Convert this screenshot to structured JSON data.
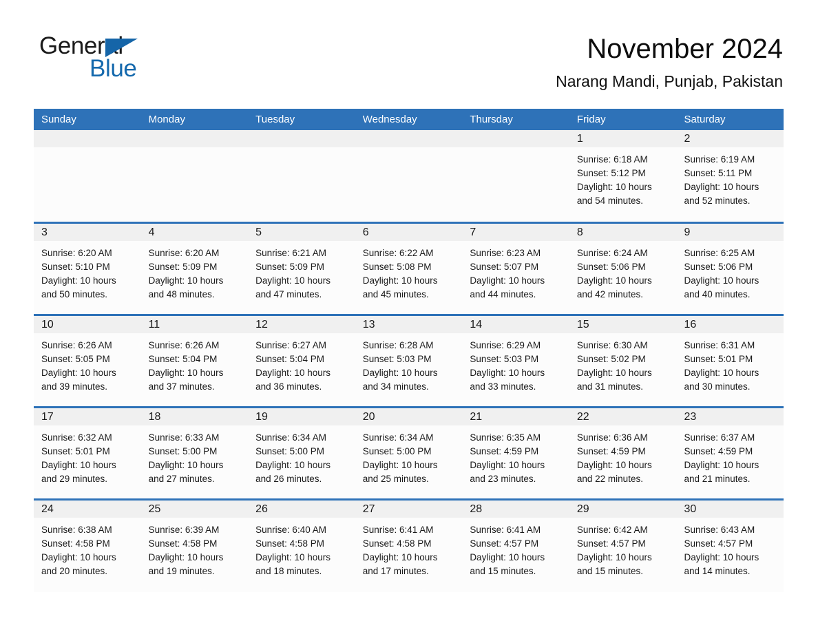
{
  "brand": {
    "name_part1": "General",
    "name_part2": "Blue",
    "triangle_color": "#1565a8",
    "blue_text_color": "#1569ad"
  },
  "header": {
    "month_title": "November 2024",
    "location": "Narang Mandi, Punjab, Pakistan"
  },
  "theme": {
    "header_blue": "#2e72b8",
    "daynum_band": "#f0f0f0",
    "cell_bg": "#fcfcfc",
    "text": "#1a1a1a"
  },
  "weekdays": [
    "Sunday",
    "Monday",
    "Tuesday",
    "Wednesday",
    "Thursday",
    "Friday",
    "Saturday"
  ],
  "weeks": [
    {
      "days": [
        {
          "num": "",
          "sunrise": "",
          "sunset": "",
          "daylight_1": "",
          "daylight_2": ""
        },
        {
          "num": "",
          "sunrise": "",
          "sunset": "",
          "daylight_1": "",
          "daylight_2": ""
        },
        {
          "num": "",
          "sunrise": "",
          "sunset": "",
          "daylight_1": "",
          "daylight_2": ""
        },
        {
          "num": "",
          "sunrise": "",
          "sunset": "",
          "daylight_1": "",
          "daylight_2": ""
        },
        {
          "num": "",
          "sunrise": "",
          "sunset": "",
          "daylight_1": "",
          "daylight_2": ""
        },
        {
          "num": "1",
          "sunrise": "Sunrise: 6:18 AM",
          "sunset": "Sunset: 5:12 PM",
          "daylight_1": "Daylight: 10 hours",
          "daylight_2": "and 54 minutes."
        },
        {
          "num": "2",
          "sunrise": "Sunrise: 6:19 AM",
          "sunset": "Sunset: 5:11 PM",
          "daylight_1": "Daylight: 10 hours",
          "daylight_2": "and 52 minutes."
        }
      ]
    },
    {
      "days": [
        {
          "num": "3",
          "sunrise": "Sunrise: 6:20 AM",
          "sunset": "Sunset: 5:10 PM",
          "daylight_1": "Daylight: 10 hours",
          "daylight_2": "and 50 minutes."
        },
        {
          "num": "4",
          "sunrise": "Sunrise: 6:20 AM",
          "sunset": "Sunset: 5:09 PM",
          "daylight_1": "Daylight: 10 hours",
          "daylight_2": "and 48 minutes."
        },
        {
          "num": "5",
          "sunrise": "Sunrise: 6:21 AM",
          "sunset": "Sunset: 5:09 PM",
          "daylight_1": "Daylight: 10 hours",
          "daylight_2": "and 47 minutes."
        },
        {
          "num": "6",
          "sunrise": "Sunrise: 6:22 AM",
          "sunset": "Sunset: 5:08 PM",
          "daylight_1": "Daylight: 10 hours",
          "daylight_2": "and 45 minutes."
        },
        {
          "num": "7",
          "sunrise": "Sunrise: 6:23 AM",
          "sunset": "Sunset: 5:07 PM",
          "daylight_1": "Daylight: 10 hours",
          "daylight_2": "and 44 minutes."
        },
        {
          "num": "8",
          "sunrise": "Sunrise: 6:24 AM",
          "sunset": "Sunset: 5:06 PM",
          "daylight_1": "Daylight: 10 hours",
          "daylight_2": "and 42 minutes."
        },
        {
          "num": "9",
          "sunrise": "Sunrise: 6:25 AM",
          "sunset": "Sunset: 5:06 PM",
          "daylight_1": "Daylight: 10 hours",
          "daylight_2": "and 40 minutes."
        }
      ]
    },
    {
      "days": [
        {
          "num": "10",
          "sunrise": "Sunrise: 6:26 AM",
          "sunset": "Sunset: 5:05 PM",
          "daylight_1": "Daylight: 10 hours",
          "daylight_2": "and 39 minutes."
        },
        {
          "num": "11",
          "sunrise": "Sunrise: 6:26 AM",
          "sunset": "Sunset: 5:04 PM",
          "daylight_1": "Daylight: 10 hours",
          "daylight_2": "and 37 minutes."
        },
        {
          "num": "12",
          "sunrise": "Sunrise: 6:27 AM",
          "sunset": "Sunset: 5:04 PM",
          "daylight_1": "Daylight: 10 hours",
          "daylight_2": "and 36 minutes."
        },
        {
          "num": "13",
          "sunrise": "Sunrise: 6:28 AM",
          "sunset": "Sunset: 5:03 PM",
          "daylight_1": "Daylight: 10 hours",
          "daylight_2": "and 34 minutes."
        },
        {
          "num": "14",
          "sunrise": "Sunrise: 6:29 AM",
          "sunset": "Sunset: 5:03 PM",
          "daylight_1": "Daylight: 10 hours",
          "daylight_2": "and 33 minutes."
        },
        {
          "num": "15",
          "sunrise": "Sunrise: 6:30 AM",
          "sunset": "Sunset: 5:02 PM",
          "daylight_1": "Daylight: 10 hours",
          "daylight_2": "and 31 minutes."
        },
        {
          "num": "16",
          "sunrise": "Sunrise: 6:31 AM",
          "sunset": "Sunset: 5:01 PM",
          "daylight_1": "Daylight: 10 hours",
          "daylight_2": "and 30 minutes."
        }
      ]
    },
    {
      "days": [
        {
          "num": "17",
          "sunrise": "Sunrise: 6:32 AM",
          "sunset": "Sunset: 5:01 PM",
          "daylight_1": "Daylight: 10 hours",
          "daylight_2": "and 29 minutes."
        },
        {
          "num": "18",
          "sunrise": "Sunrise: 6:33 AM",
          "sunset": "Sunset: 5:00 PM",
          "daylight_1": "Daylight: 10 hours",
          "daylight_2": "and 27 minutes."
        },
        {
          "num": "19",
          "sunrise": "Sunrise: 6:34 AM",
          "sunset": "Sunset: 5:00 PM",
          "daylight_1": "Daylight: 10 hours",
          "daylight_2": "and 26 minutes."
        },
        {
          "num": "20",
          "sunrise": "Sunrise: 6:34 AM",
          "sunset": "Sunset: 5:00 PM",
          "daylight_1": "Daylight: 10 hours",
          "daylight_2": "and 25 minutes."
        },
        {
          "num": "21",
          "sunrise": "Sunrise: 6:35 AM",
          "sunset": "Sunset: 4:59 PM",
          "daylight_1": "Daylight: 10 hours",
          "daylight_2": "and 23 minutes."
        },
        {
          "num": "22",
          "sunrise": "Sunrise: 6:36 AM",
          "sunset": "Sunset: 4:59 PM",
          "daylight_1": "Daylight: 10 hours",
          "daylight_2": "and 22 minutes."
        },
        {
          "num": "23",
          "sunrise": "Sunrise: 6:37 AM",
          "sunset": "Sunset: 4:59 PM",
          "daylight_1": "Daylight: 10 hours",
          "daylight_2": "and 21 minutes."
        }
      ]
    },
    {
      "days": [
        {
          "num": "24",
          "sunrise": "Sunrise: 6:38 AM",
          "sunset": "Sunset: 4:58 PM",
          "daylight_1": "Daylight: 10 hours",
          "daylight_2": "and 20 minutes."
        },
        {
          "num": "25",
          "sunrise": "Sunrise: 6:39 AM",
          "sunset": "Sunset: 4:58 PM",
          "daylight_1": "Daylight: 10 hours",
          "daylight_2": "and 19 minutes."
        },
        {
          "num": "26",
          "sunrise": "Sunrise: 6:40 AM",
          "sunset": "Sunset: 4:58 PM",
          "daylight_1": "Daylight: 10 hours",
          "daylight_2": "and 18 minutes."
        },
        {
          "num": "27",
          "sunrise": "Sunrise: 6:41 AM",
          "sunset": "Sunset: 4:58 PM",
          "daylight_1": "Daylight: 10 hours",
          "daylight_2": "and 17 minutes."
        },
        {
          "num": "28",
          "sunrise": "Sunrise: 6:41 AM",
          "sunset": "Sunset: 4:57 PM",
          "daylight_1": "Daylight: 10 hours",
          "daylight_2": "and 15 minutes."
        },
        {
          "num": "29",
          "sunrise": "Sunrise: 6:42 AM",
          "sunset": "Sunset: 4:57 PM",
          "daylight_1": "Daylight: 10 hours",
          "daylight_2": "and 15 minutes."
        },
        {
          "num": "30",
          "sunrise": "Sunrise: 6:43 AM",
          "sunset": "Sunset: 4:57 PM",
          "daylight_1": "Daylight: 10 hours",
          "daylight_2": "and 14 minutes."
        }
      ]
    }
  ]
}
